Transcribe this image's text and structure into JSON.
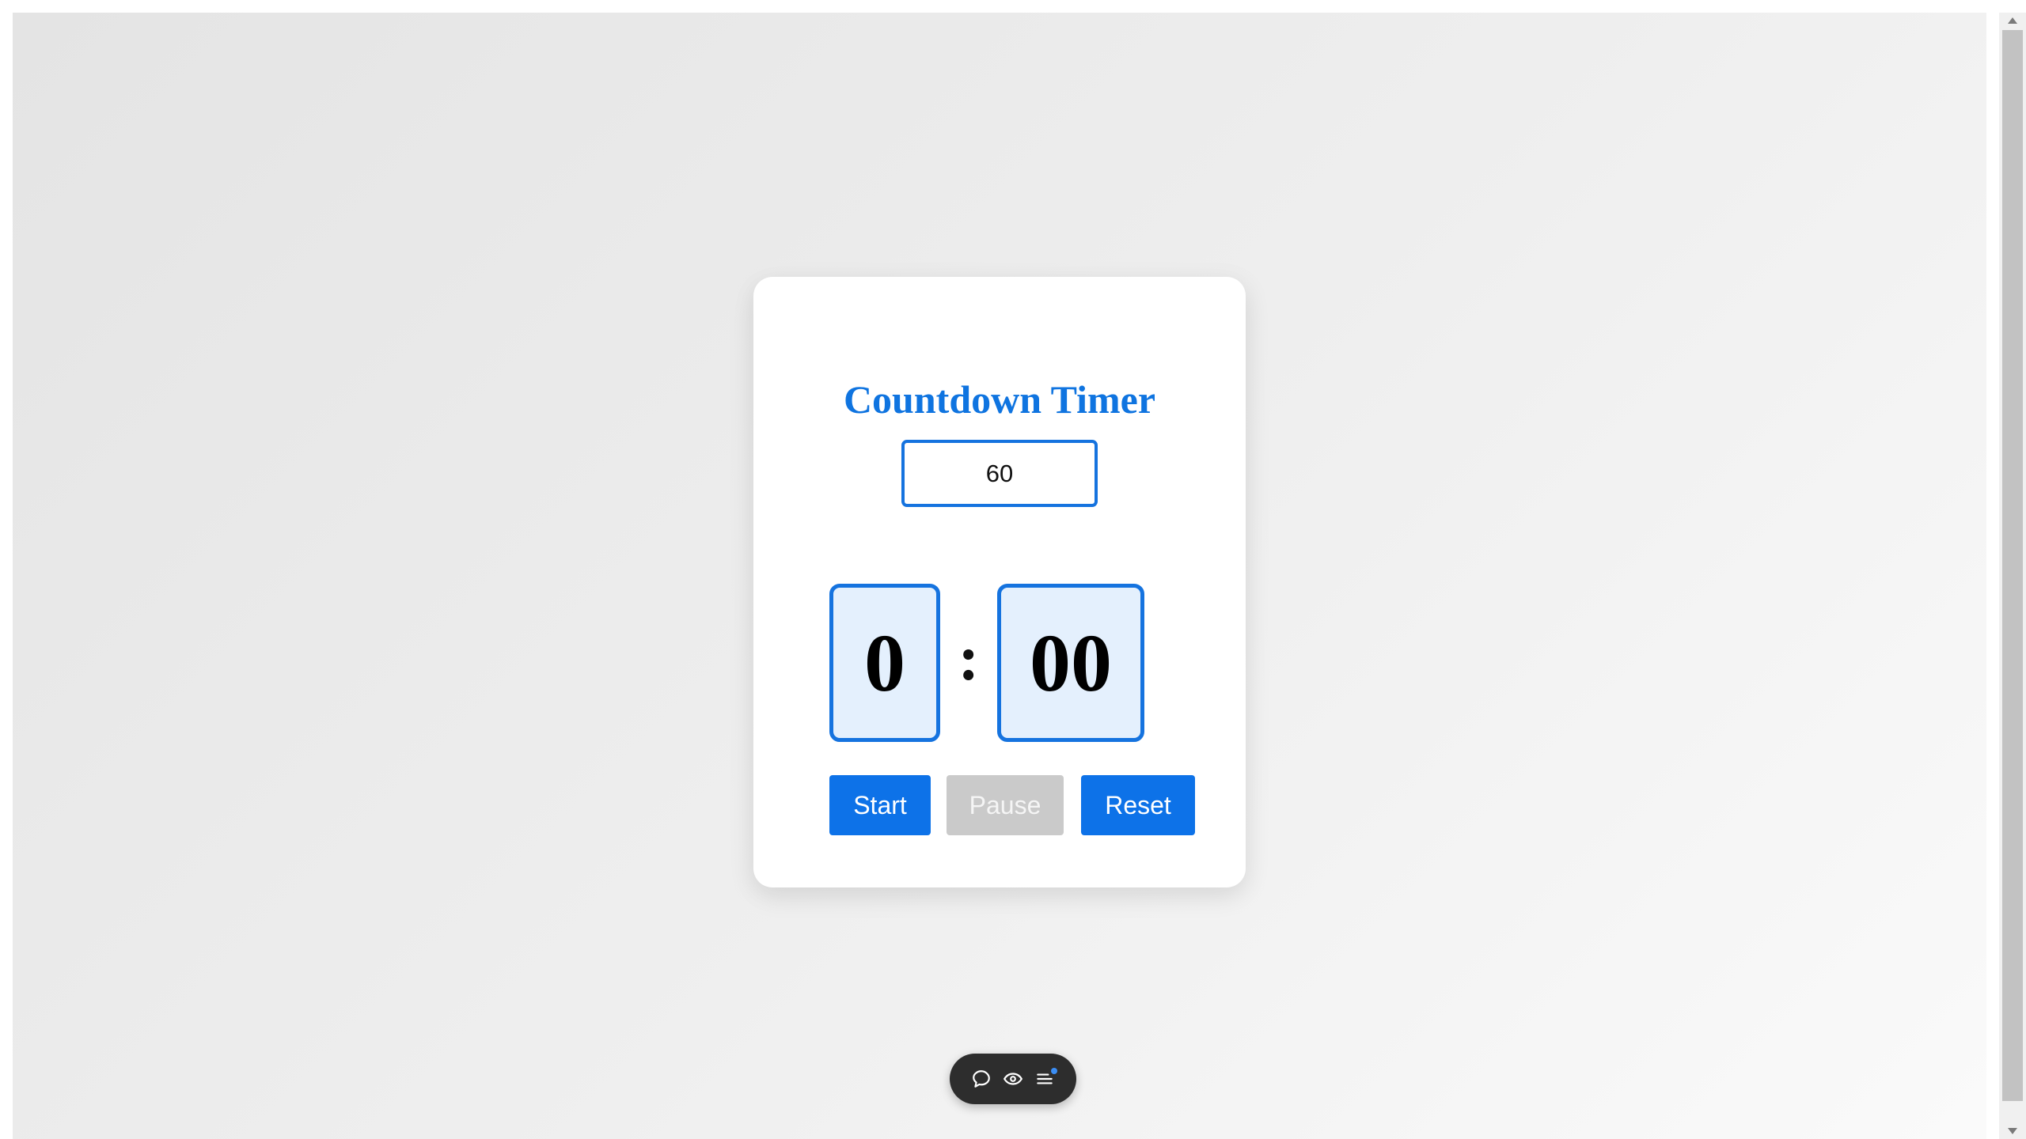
{
  "timer": {
    "title": "Countdown Timer",
    "minutes_input_value": "60",
    "display_minutes": "0",
    "separator": ":",
    "display_seconds": "00"
  },
  "controls": {
    "start_label": "Start",
    "pause_label": "Pause",
    "reset_label": "Reset",
    "pause_disabled": true
  },
  "floating_toolbar": {
    "icons": [
      "chat-bubble-icon",
      "eye-icon",
      "menu-list-icon"
    ]
  },
  "colors": {
    "accent": "#0d72e8",
    "title": "#0f74e0",
    "digit_bg": "#e4f0fd",
    "disabled": "#cacaca",
    "toolbar_bg": "#2d2d2d"
  }
}
